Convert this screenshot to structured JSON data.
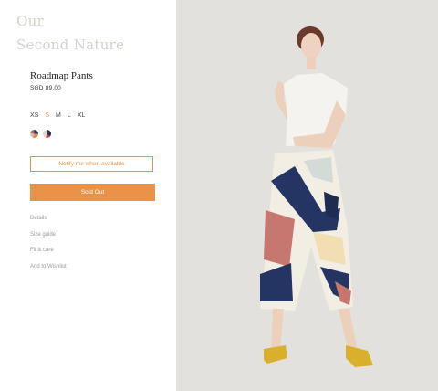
{
  "brand": {
    "line1": "Our",
    "line2": "Second Nature"
  },
  "product": {
    "name": "Roadmap Pants",
    "price": "SGD 89.00"
  },
  "sizes": [
    {
      "label": "XS",
      "selected": false
    },
    {
      "label": "S",
      "selected": true
    },
    {
      "label": "M",
      "selected": false
    },
    {
      "label": "L",
      "selected": false
    },
    {
      "label": "XL",
      "selected": false
    }
  ],
  "colors": {
    "accent": "#e8924a",
    "brand_text": "#d7d2c9",
    "background_photo": "#e3e1de"
  },
  "buttons": {
    "notify": "Notify me when available",
    "sold_out": "Sold Out"
  },
  "links": [
    "Details",
    "Size guide",
    "Fit & care",
    "Add to Wishlist"
  ]
}
